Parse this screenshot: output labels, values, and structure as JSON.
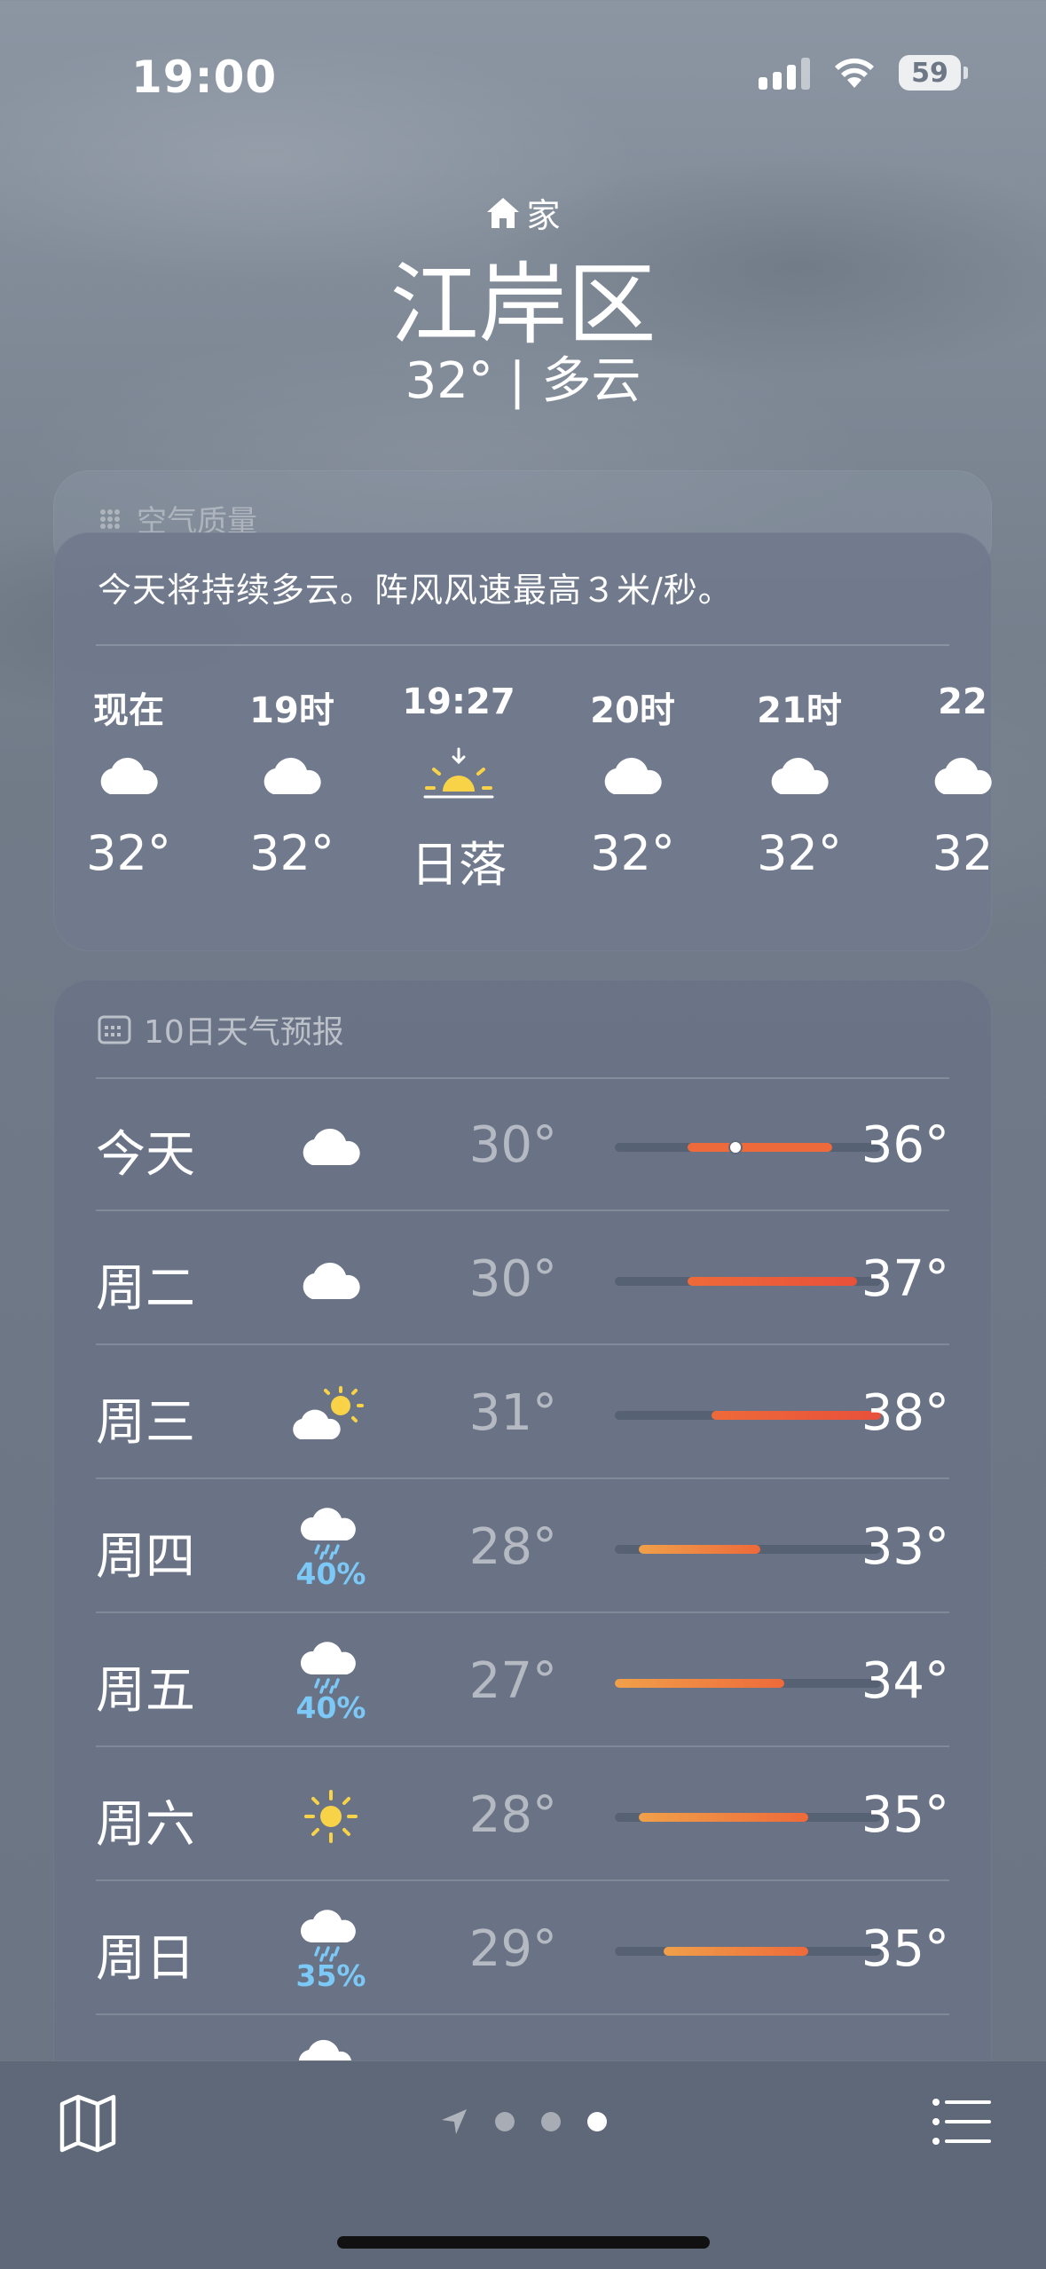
{
  "status_bar": {
    "time": "19:00",
    "battery": "59"
  },
  "header": {
    "location_tag": "家",
    "city": "江岸区",
    "summary": "32° | 多云"
  },
  "air_quality": {
    "title": "空气质量"
  },
  "hourly": {
    "description": "今天将持续多云。阵风风速最高３米/秒。",
    "items": [
      {
        "label": "现在",
        "icon": "cloud-icon",
        "value": "32°"
      },
      {
        "label": "19时",
        "icon": "cloud-icon",
        "value": "32°"
      },
      {
        "label": "19:27",
        "icon": "sunset-icon",
        "value": "日落"
      },
      {
        "label": "20时",
        "icon": "cloud-icon",
        "value": "32°"
      },
      {
        "label": "21时",
        "icon": "cloud-icon",
        "value": "32°"
      },
      {
        "label": "22",
        "icon": "cloud-icon",
        "value": "32"
      }
    ]
  },
  "daily": {
    "title": "10日天气预报",
    "range_min": 27,
    "range_max": 38,
    "items": [
      {
        "day": "今天",
        "icon": "cloud-icon",
        "pop": "",
        "low": "30°",
        "high": "36°",
        "low_v": 30,
        "high_v": 36,
        "current_v": 32
      },
      {
        "day": "周二",
        "icon": "cloud-icon",
        "pop": "",
        "low": "30°",
        "high": "37°",
        "low_v": 30,
        "high_v": 37
      },
      {
        "day": "周三",
        "icon": "partly-sunny-icon",
        "pop": "",
        "low": "31°",
        "high": "38°",
        "low_v": 31,
        "high_v": 38
      },
      {
        "day": "周四",
        "icon": "rain-icon",
        "pop": "40%",
        "low": "28°",
        "high": "33°",
        "low_v": 28,
        "high_v": 33
      },
      {
        "day": "周五",
        "icon": "rain-icon",
        "pop": "40%",
        "low": "27°",
        "high": "34°",
        "low_v": 27,
        "high_v": 34
      },
      {
        "day": "周六",
        "icon": "sun-icon",
        "pop": "",
        "low": "28°",
        "high": "35°",
        "low_v": 28,
        "high_v": 35
      },
      {
        "day": "周日",
        "icon": "rain-icon",
        "pop": "35%",
        "low": "29°",
        "high": "35°",
        "low_v": 29,
        "high_v": 35
      }
    ]
  },
  "colors": {
    "bar_cool": "#f0a04a",
    "bar_warm": "#ee6a3a",
    "bar_hot": "#e8503a",
    "precip": "#7cc8f7"
  }
}
